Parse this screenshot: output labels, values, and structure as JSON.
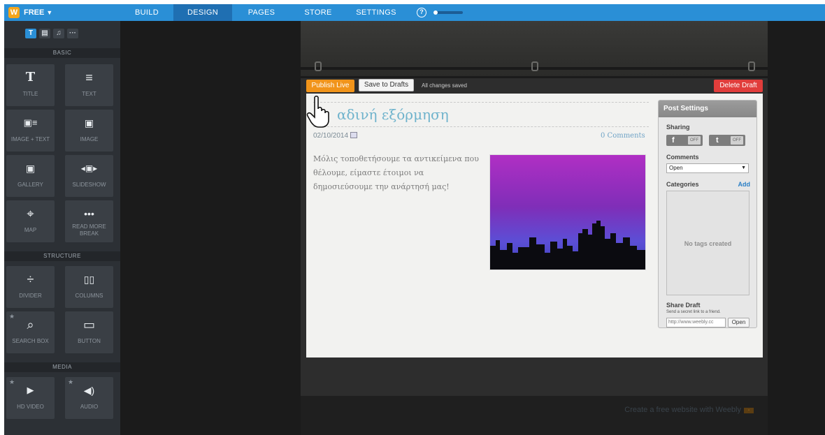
{
  "topbar": {
    "logo": "W",
    "plan": "FREE",
    "nav": [
      "BUILD",
      "DESIGN",
      "PAGES",
      "STORE",
      "SETTINGS"
    ],
    "help": "?"
  },
  "sidebar": {
    "tabs": [
      "T",
      "▤",
      "♫",
      "···"
    ],
    "sections": {
      "basic": "BASIC",
      "structure": "STRUCTURE",
      "media": "MEDIA"
    },
    "elements": [
      {
        "glyph": "T",
        "label": "TITLE",
        "icon": "title-icon"
      },
      {
        "glyph": "≡",
        "label": "TEXT",
        "icon": "text-icon"
      },
      {
        "glyph": "▣≡",
        "label": "IMAGE + TEXT",
        "icon": "image-text-icon"
      },
      {
        "glyph": "▣",
        "label": "IMAGE",
        "icon": "image-icon"
      },
      {
        "glyph": "▣",
        "label": "GALLERY",
        "icon": "gallery-icon"
      },
      {
        "glyph": "◂▣▸",
        "label": "SLIDESHOW",
        "icon": "slideshow-icon"
      },
      {
        "glyph": "⌖",
        "label": "MAP",
        "icon": "map-icon"
      },
      {
        "glyph": "•••",
        "label": "READ MORE BREAK",
        "icon": "read-more-icon"
      },
      {
        "glyph": "÷",
        "label": "DIVIDER",
        "icon": "divider-icon"
      },
      {
        "glyph": "▯▯",
        "label": "COLUMNS",
        "icon": "columns-icon"
      },
      {
        "glyph": "⌕",
        "label": "SEARCH BOX",
        "icon": "search-icon"
      },
      {
        "glyph": "▭",
        "label": "BUTTON",
        "icon": "button-icon"
      },
      {
        "glyph": "▶",
        "label": "HD VIDEO",
        "icon": "video-icon"
      },
      {
        "glyph": "◀)",
        "label": "AUDIO",
        "icon": "audio-icon"
      }
    ]
  },
  "toolbar": {
    "publish": "Publish Live",
    "drafts": "Save to Drafts",
    "saved": "All changes saved",
    "delete": "Delete Draft"
  },
  "post": {
    "title": "αδινή εξόρμηση",
    "date": "02/10/2014",
    "comments": "0 Comments",
    "body": "Μόλις τοποθετήσουμε τα αντικείμενα που θέλουμε, είμαστε έτοιμοι να δημοσιεύσουμε την ανάρτησή μας!"
  },
  "settings": {
    "title": "Post Settings",
    "sharing": "Sharing",
    "facebook": "f",
    "twitter": "t",
    "off": "OFF",
    "comments_label": "Comments",
    "comments_value": "Open",
    "categories": "Categories",
    "add": "Add",
    "no_tags": "No tags created",
    "share_title": "Share Draft",
    "share_desc": "Send a secret link to a friend.",
    "share_url": "http://www.weebly.cc",
    "open": "Open"
  },
  "footer": {
    "text": "Create a free website with",
    "brand": "Weebly"
  }
}
